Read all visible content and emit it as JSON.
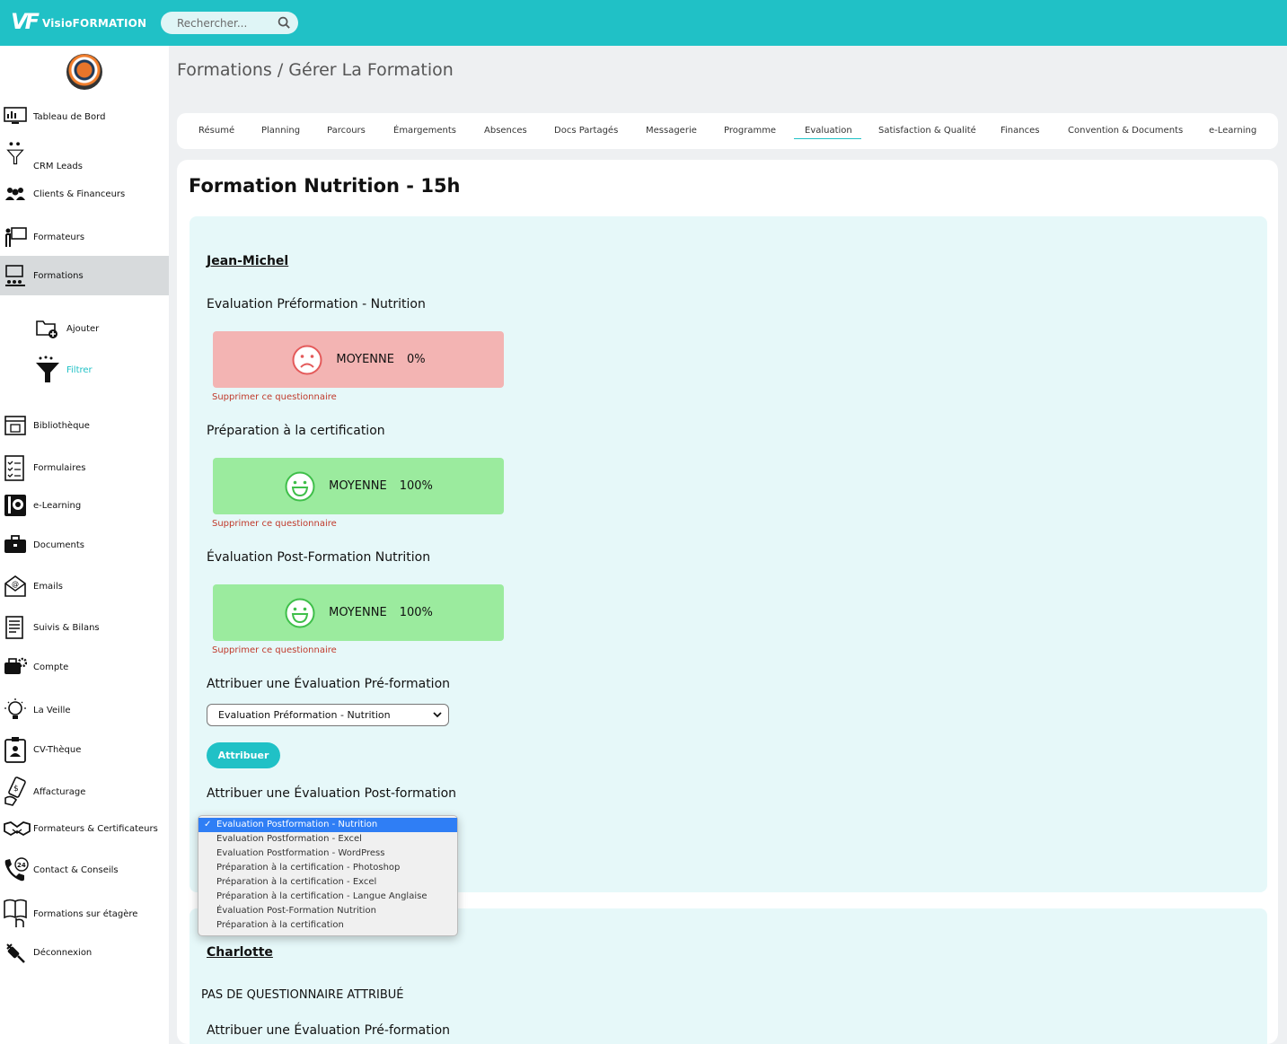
{
  "app": {
    "logo_mark": "VF",
    "logo_text": "VisioFORMATION",
    "search_placeholder": "Rechercher..."
  },
  "sidebar": {
    "items": [
      {
        "label": "Tableau de Bord",
        "icon": "dashboard-icon"
      },
      {
        "label": "CRM Leads",
        "icon": "crm-funnel-icon"
      },
      {
        "label": "Clients & Financeurs",
        "icon": "clients-group-icon"
      },
      {
        "label": "Formateurs",
        "icon": "trainer-icon"
      },
      {
        "label": "Formations",
        "icon": "training-board-icon"
      },
      {
        "label": "Ajouter",
        "icon": "add-folder-icon"
      },
      {
        "label": "Filtrer",
        "icon": "filter-icon"
      },
      {
        "label": "Bibliothèque",
        "icon": "library-icon"
      },
      {
        "label": "Formulaires",
        "icon": "form-checklist-icon"
      },
      {
        "label": "e-Learning",
        "icon": "elearning-icon"
      },
      {
        "label": "Documents",
        "icon": "briefcase-icon"
      },
      {
        "label": "Emails",
        "icon": "email-icon"
      },
      {
        "label": "Suivis & Bilans",
        "icon": "report-icon"
      },
      {
        "label": "Compte",
        "icon": "account-gear-icon"
      },
      {
        "label": "La Veille",
        "icon": "lightbulb-icon"
      },
      {
        "label": "CV-Thèque",
        "icon": "cv-badge-icon"
      },
      {
        "label": "Affacturage",
        "icon": "money-hand-icon"
      },
      {
        "label": "Formateurs & Certificateurs",
        "icon": "handshake-icon"
      },
      {
        "label": "Contact & Conseils",
        "icon": "phone-24-icon"
      },
      {
        "label": "Formations sur étagère",
        "icon": "book-hand-icon"
      },
      {
        "label": "Déconnexion",
        "icon": "plug-icon"
      }
    ]
  },
  "breadcrumb": "Formations / Gérer La Formation",
  "tabs": [
    "Résumé",
    "Planning",
    "Parcours",
    "Émargements",
    "Absences",
    "Docs Partagés",
    "Messagerie",
    "Programme",
    "Evaluation",
    "Satisfaction & Qualité",
    "Finances",
    "Convention & Documents",
    "e-Learning"
  ],
  "active_tab": "Evaluation",
  "formation_title": "Formation Nutrition - 15h",
  "student1": {
    "name": "Jean-Michel",
    "evaluations": [
      {
        "title": "Evaluation Préformation - Nutrition",
        "label": "MOYENNE",
        "score": "0%",
        "mood": "sad"
      },
      {
        "title": "Préparation à la certification",
        "label": "MOYENNE",
        "score": "100%",
        "mood": "happy"
      },
      {
        "title": "Évaluation Post-Formation Nutrition",
        "label": "MOYENNE",
        "score": "100%",
        "mood": "happy"
      }
    ],
    "delete_label": "Supprimer ce questionnaire",
    "assign_pre_title": "Attribuer une Évaluation Pré-formation",
    "assign_pre_value": "Evaluation Préformation - Nutrition",
    "assign_button": "Attribuer",
    "assign_post_title": "Attribuer une Évaluation Post-formation"
  },
  "dropdown_options": [
    "Evaluation Postformation - Nutrition",
    "Evaluation Postformation - Excel",
    "Evaluation Postformation - WordPress",
    "Préparation à la certification - Photoshop",
    "Préparation à la certification - Excel",
    "Préparation à la certification - Langue Anglaise",
    "Évaluation Post-Formation Nutrition",
    "Préparation à la certification"
  ],
  "dropdown_selected": "Evaluation Postformation - Nutrition",
  "student2": {
    "name": "Charlotte",
    "status": "PAS DE QUESTIONNAIRE ATTRIBUÉ",
    "assign_pre_title": "Attribuer une Évaluation Pré-formation"
  },
  "colors": {
    "accent": "#20c1c6",
    "bad": "#f3b4b3",
    "good": "#9beb9e",
    "delete": "#c0392b",
    "selected_option": "#2f7ef5"
  }
}
